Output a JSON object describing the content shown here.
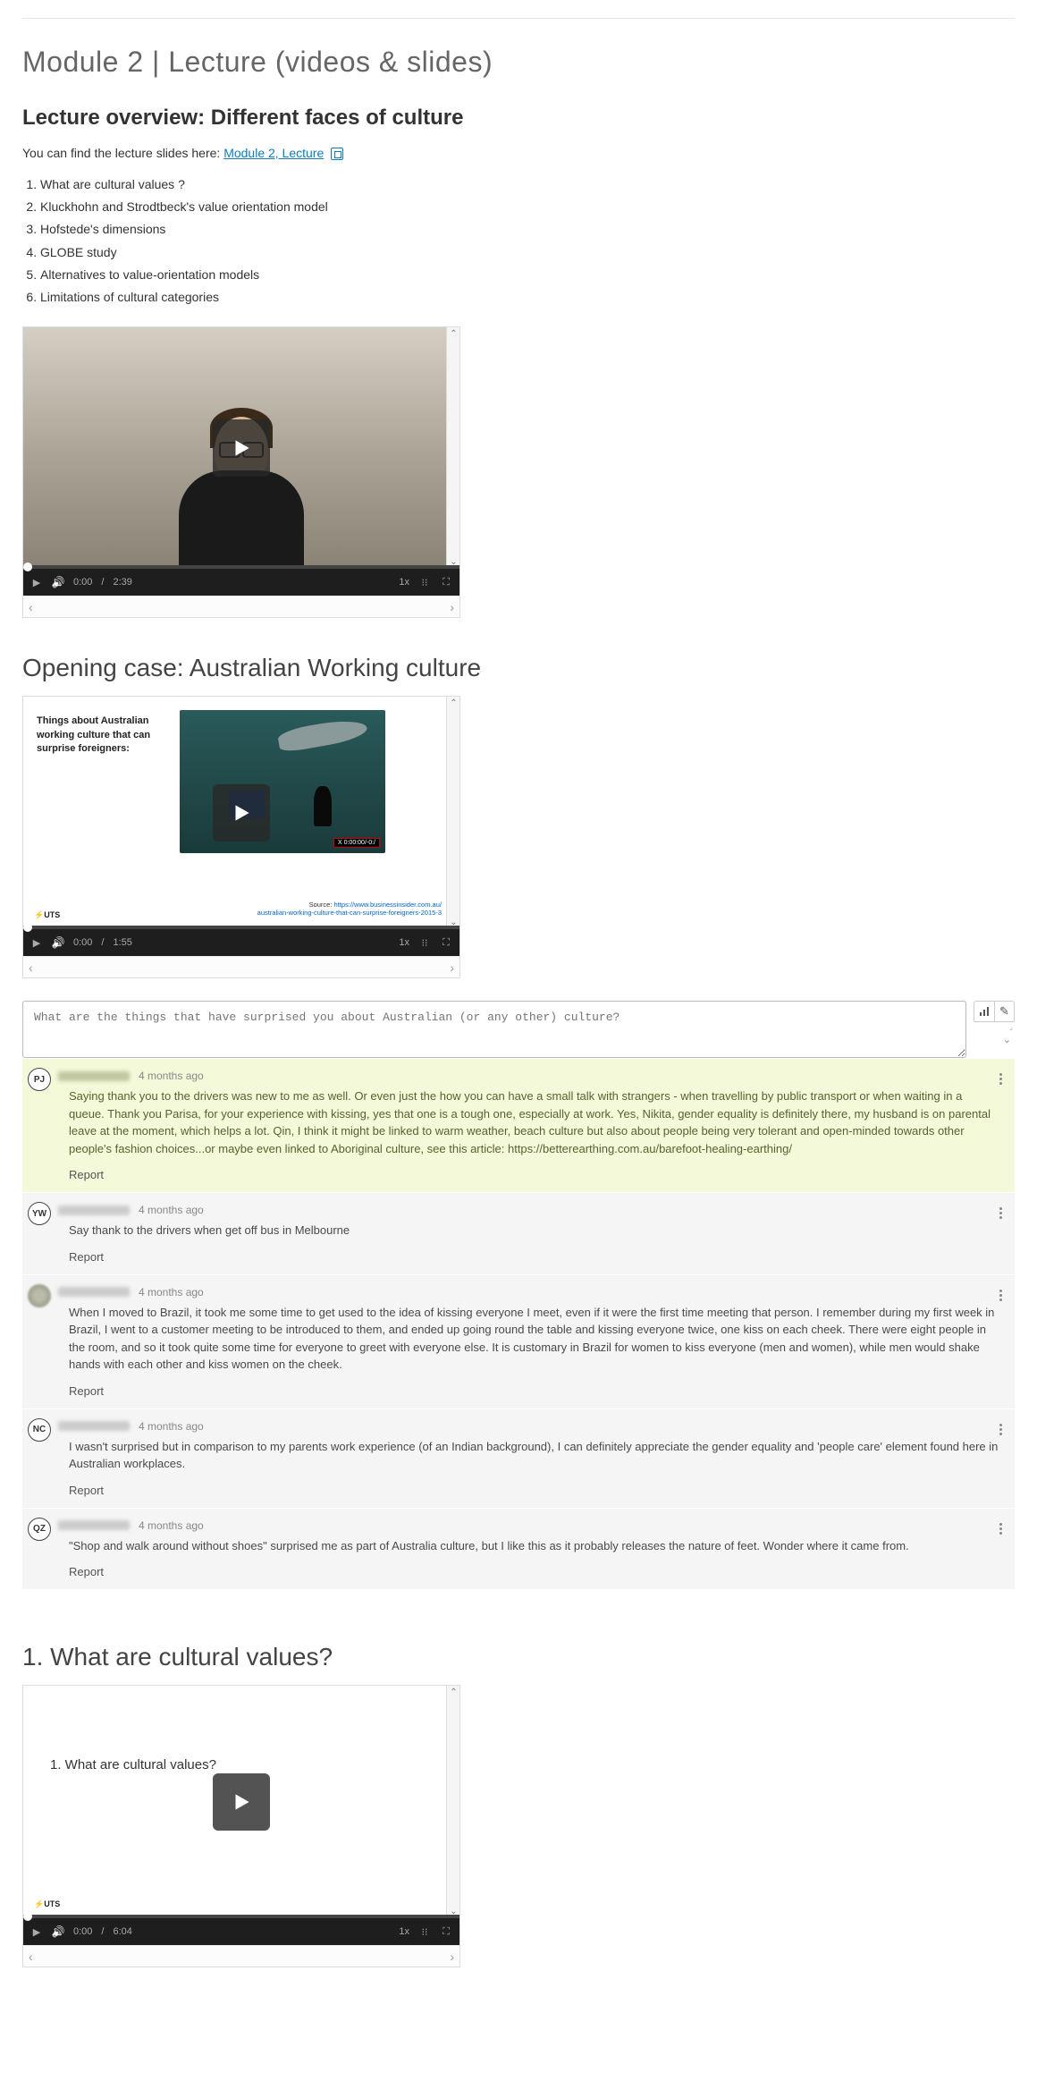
{
  "page_title": "Module 2 | Lecture (videos & slides)",
  "overview": {
    "heading": "Lecture overview: Different faces of culture",
    "intro_prefix": "You can find the lecture slides here: ",
    "link_text": "Module 2, Lecture",
    "items": [
      "What are cultural values ?",
      "Kluckhohn and Strodtbeck's value orientation model",
      "Hofstede's dimensions",
      "GLOBE study",
      "Alternatives to value-orientation models",
      "Limitations of cultural categories"
    ]
  },
  "video1": {
    "time_current": "0:00",
    "time_total": "2:39",
    "speed": "1x"
  },
  "case": {
    "heading": "Opening case: Australian Working culture",
    "slide_text": "Things about Australian working culture that can surprise foreigners:",
    "rec_label": "X 0:00:00/-0:/",
    "src_label": "Source:",
    "src_url": "https://www.businessinsider.com.au/",
    "src_url2": "australian-working-culture-that-can-surprise-foreigners-2015-3",
    "uts": "⚡UTS",
    "time_current": "0:00",
    "time_total": "1:55",
    "speed": "1x"
  },
  "comment_prompt": "What are the things that have surprised you about Australian (or any other) culture?",
  "comments": [
    {
      "initials": "PJ",
      "avatar_type": "initials",
      "highlight": true,
      "time": "4 months ago",
      "body": "Saying thank you to the drivers was new to me as well. Or even just the how you can have a small talk with strangers - when travelling by public transport or when waiting in a queue. Thank you Parisa, for your experience with kissing, yes that one is a tough one, especially at work. Yes, Nikita, gender equality is definitely there, my husband is on parental leave at the moment, which helps a lot. Qin, I think it might be linked to warm weather, beach culture but also about people being very tolerant and open-minded towards other people's fashion choices...or maybe even linked to Aboriginal culture, see this article: https://betterearthing.com.au/barefoot-healing-earthing/",
      "report": "Report"
    },
    {
      "initials": "YW",
      "avatar_type": "initials",
      "highlight": false,
      "time": "4 months ago",
      "body": "Say thank to the drivers when get off bus in Melbourne",
      "report": "Report"
    },
    {
      "initials": "",
      "avatar_type": "blur",
      "highlight": false,
      "time": "4 months ago",
      "body": "When I moved to Brazil, it took me some time to get used to the idea of kissing everyone I meet, even if it were the first time meeting that person. I remember during my first week in Brazil, I went to a customer meeting to be introduced to them, and ended up going round the table and kissing everyone twice, one kiss on each cheek. There were eight people in the room, and so it took quite some time for everyone to greet with everyone else. It is customary in Brazil for women to kiss everyone (men and women), while men would shake hands with each other and kiss women on the cheek.",
      "report": "Report"
    },
    {
      "initials": "NC",
      "avatar_type": "initials",
      "highlight": false,
      "time": "4 months ago",
      "body": "I wasn't surprised but in comparison to my parents work experience (of an Indian background), I can definitely appreciate the gender equality and 'people care' element found here in Australian workplaces.",
      "report": "Report"
    },
    {
      "initials": "QZ",
      "avatar_type": "initials",
      "highlight": false,
      "time": "4 months ago",
      "body": "\"Shop and walk around without shoes\" surprised me as part of Australia culture, but I like this as it probably releases the nature of feet. Wonder where it came from.",
      "report": "Report"
    }
  ],
  "section1": {
    "heading": "1. What are cultural values?",
    "slide_heading": "1. What are cultural values?",
    "uts": "⚡UTS",
    "time_current": "0:00",
    "time_total": "6:04",
    "speed": "1x"
  },
  "expand_label": "⌄"
}
